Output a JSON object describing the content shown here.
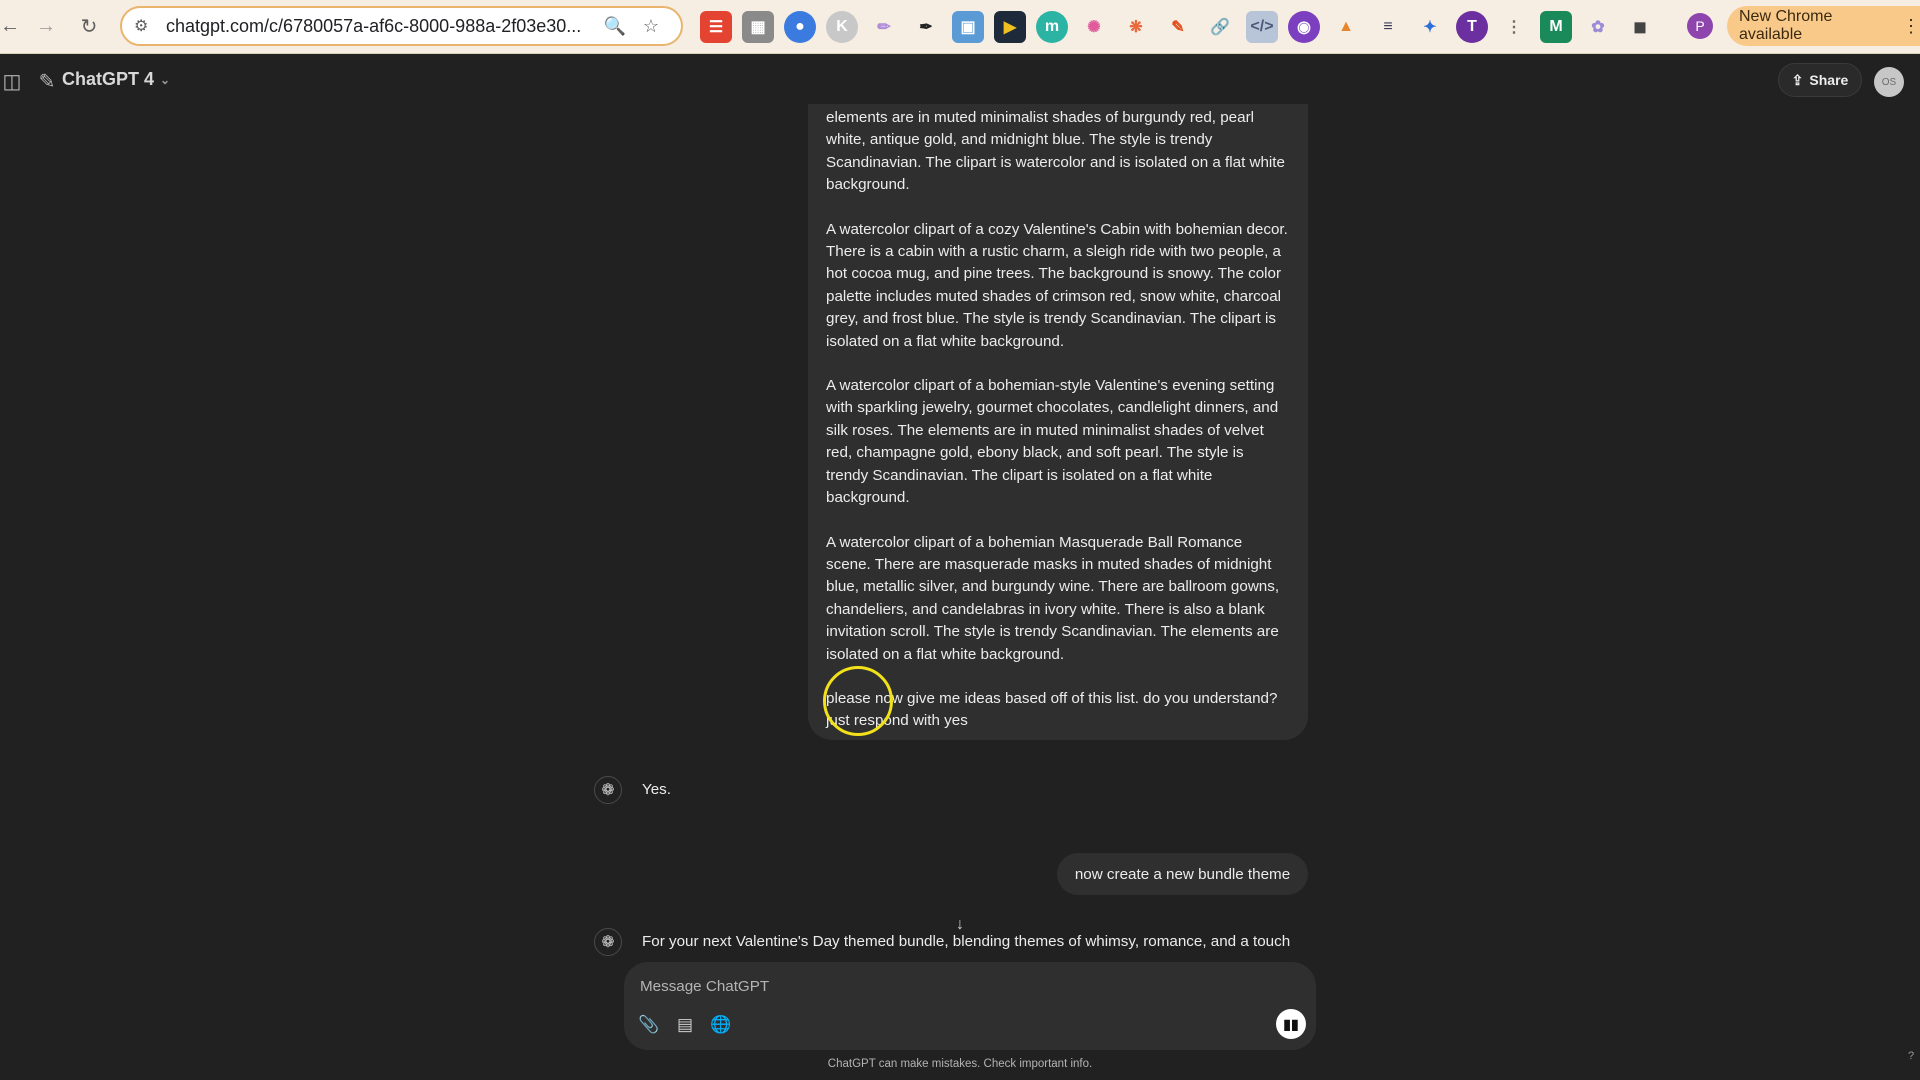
{
  "browser": {
    "url": "chatgpt.com/c/6780057a-af6c-8000-988a-2f03e30...",
    "update_label": "New Chrome available",
    "profile_initial": "P",
    "extensions": [
      "todoist-icon",
      "notes-icon",
      "chat-icon",
      "k-icon",
      "pen-icon",
      "dropper-icon",
      "screenshot-icon",
      "play-icon",
      "m-circle-icon",
      "color-wheel-icon",
      "chrome-swirl-icon",
      "pencil-icon",
      "link-icon",
      "code-icon",
      "eye-icon",
      "fox-icon",
      "stack-icon",
      "bird-icon",
      "t-icon",
      "dots-icon",
      "m-logo-icon",
      "brain-icon",
      "puzzle-icon"
    ]
  },
  "header": {
    "model_name": "ChatGPT 4",
    "share_label": "Share",
    "avatar_text": "OS"
  },
  "conversation": {
    "long_message_paragraphs": [
      "elements are in muted minimalist shades of burgundy red, pearl white, antique gold, and midnight blue. The style is trendy Scandinavian. The clipart is watercolor and is isolated on a flat white background.",
      "A watercolor clipart of a cozy Valentine's Cabin with bohemian decor. There is a cabin with a rustic charm, a sleigh ride with two people, a hot cocoa mug, and pine trees. The background is snowy. The color palette includes muted shades of crimson red, snow white, charcoal grey, and frost blue. The style is trendy Scandinavian. The clipart is isolated on a flat white background.",
      "A watercolor clipart of a bohemian-style Valentine's evening setting with sparkling jewelry, gourmet chocolates, candlelight dinners, and silk roses. The elements are in muted minimalist shades of velvet red, champagne gold, ebony black, and soft pearl. The style is trendy Scandinavian. The clipart is isolated on a flat white background.",
      "A watercolor clipart of a bohemian Masquerade Ball Romance scene. There are masquerade masks in muted shades of midnight blue, metallic silver, and burgundy wine. There are ballroom gowns, chandeliers, and candelabras in ivory white. There is also a blank invitation scroll. The style is trendy Scandinavian. The elements are isolated on a flat white background.",
      "please now give me ideas based off of this list. do you understand? just respond with yes"
    ],
    "assistant_reply_1": "Yes.",
    "user_message_2": "now create a new bundle theme",
    "assistant_reply_2": "For your next Valentine's Day themed bundle, blending themes of whimsy, romance, and a touch"
  },
  "composer": {
    "placeholder": "Message ChatGPT",
    "disclaimer": "ChatGPT can make mistakes. Check important info."
  },
  "colors": {
    "background": "#212121",
    "bubble": "#2f2f2f",
    "cursor_highlight": "#f1e01a",
    "chrome_bar": "#f6eee3"
  }
}
